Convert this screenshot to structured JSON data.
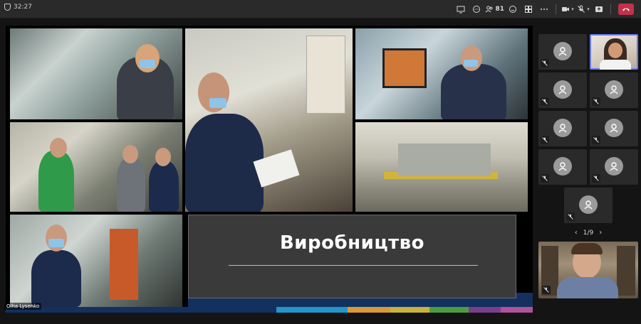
{
  "toolbar": {
    "timer": "32:27",
    "participant_count": "81"
  },
  "slide": {
    "title": "Виробництво",
    "speaker_name": "Olha Lysenko"
  },
  "gallery": {
    "page": "1/9"
  },
  "colors": {
    "toolbar_bg": "#2a2a2a",
    "leave_red": "#c4314b",
    "active_speaker_border": "#6a7bf0",
    "slide_navy": "#13305f"
  },
  "color_strip": [
    "#13305f",
    "#13305f",
    "#2196c9",
    "#d79a36",
    "#c9b23a",
    "#4d9d3e",
    "#7a3e8f",
    "#b0529a"
  ]
}
